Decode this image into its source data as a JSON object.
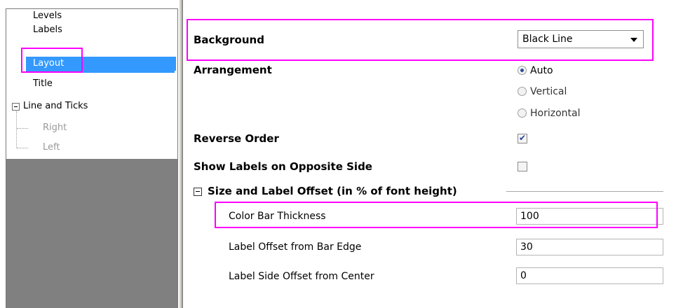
{
  "tree": {
    "items": [
      {
        "label": "Levels"
      },
      {
        "label": "Labels"
      },
      {
        "label": "Layout"
      },
      {
        "label": "Title"
      },
      {
        "label": "Line and Ticks"
      },
      {
        "label": "Right"
      },
      {
        "label": "Left"
      }
    ],
    "selected": "Layout"
  },
  "props": {
    "background": {
      "label": "Background",
      "value": "Black Line"
    },
    "arrangement": {
      "label": "Arrangement",
      "options": [
        "Auto",
        "Vertical",
        "Horizontal"
      ],
      "selected": "Auto"
    },
    "reverse_order": {
      "label": "Reverse Order",
      "checked": true
    },
    "show_labels_opposite": {
      "label": "Show Labels on Opposite Side",
      "checked": false
    },
    "size_section": {
      "label": "Size and Label Offset (in % of font height)",
      "rows": [
        {
          "label": "Color Bar Thickness",
          "value": "100"
        },
        {
          "label": "Label Offset from Bar Edge",
          "value": "30"
        },
        {
          "label": "Label Side Offset from Center",
          "value": "0"
        }
      ]
    }
  },
  "colors": {
    "highlight": "#ff00ff",
    "selection": "#3399ff",
    "panel_gray": "#808080"
  }
}
